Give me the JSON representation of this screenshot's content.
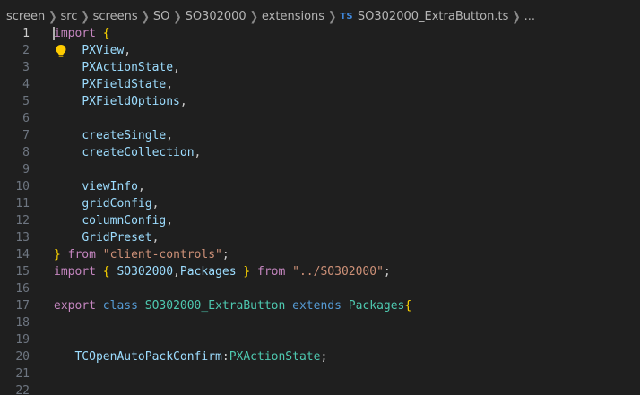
{
  "breadcrumb": {
    "items": [
      "screen",
      "src",
      "screens",
      "SO",
      "SO302000",
      "extensions"
    ],
    "file_badge": "TS",
    "file_name": "SO302000_ExtraButton.ts",
    "more": "..."
  },
  "editor": {
    "active_line": 1,
    "lightbulb_line": 2,
    "colors": {
      "background": "#1f1f1f",
      "line_number": "#6e7681",
      "keyword": "#569cd6",
      "control_keyword": "#c586c0",
      "type": "#4ec9b0",
      "identifier": "#9cdcfe",
      "string": "#ce9178",
      "brace": "#ffd700"
    },
    "lines": [
      {
        "n": "1",
        "tokens": [
          [
            "kw-ctrl",
            "import"
          ],
          [
            "punct",
            " "
          ],
          [
            "brace1",
            "{"
          ]
        ]
      },
      {
        "n": "2",
        "tokens": [
          [
            "punct",
            "    "
          ],
          [
            "ident",
            "PXView"
          ],
          [
            "punct",
            ","
          ]
        ]
      },
      {
        "n": "3",
        "tokens": [
          [
            "punct",
            "    "
          ],
          [
            "ident",
            "PXActionState"
          ],
          [
            "punct",
            ","
          ]
        ]
      },
      {
        "n": "4",
        "tokens": [
          [
            "punct",
            "    "
          ],
          [
            "ident",
            "PXFieldState"
          ],
          [
            "punct",
            ","
          ]
        ]
      },
      {
        "n": "5",
        "tokens": [
          [
            "punct",
            "    "
          ],
          [
            "ident",
            "PXFieldOptions"
          ],
          [
            "punct",
            ","
          ]
        ]
      },
      {
        "n": "6",
        "tokens": []
      },
      {
        "n": "7",
        "tokens": [
          [
            "punct",
            "    "
          ],
          [
            "ident",
            "createSingle"
          ],
          [
            "punct",
            ","
          ]
        ]
      },
      {
        "n": "8",
        "tokens": [
          [
            "punct",
            "    "
          ],
          [
            "ident",
            "createCollection"
          ],
          [
            "punct",
            ","
          ]
        ]
      },
      {
        "n": "9",
        "tokens": []
      },
      {
        "n": "10",
        "tokens": [
          [
            "punct",
            "    "
          ],
          [
            "ident",
            "viewInfo"
          ],
          [
            "punct",
            ","
          ]
        ]
      },
      {
        "n": "11",
        "tokens": [
          [
            "punct",
            "    "
          ],
          [
            "ident",
            "gridConfig"
          ],
          [
            "punct",
            ","
          ]
        ]
      },
      {
        "n": "12",
        "tokens": [
          [
            "punct",
            "    "
          ],
          [
            "ident",
            "columnConfig"
          ],
          [
            "punct",
            ","
          ]
        ]
      },
      {
        "n": "13",
        "tokens": [
          [
            "punct",
            "    "
          ],
          [
            "ident",
            "GridPreset"
          ],
          [
            "punct",
            ","
          ]
        ]
      },
      {
        "n": "14",
        "tokens": [
          [
            "brace1",
            "}"
          ],
          [
            "punct",
            " "
          ],
          [
            "kw-ctrl",
            "from"
          ],
          [
            "punct",
            " "
          ],
          [
            "str",
            "\"client-controls\""
          ],
          [
            "punct",
            ";"
          ]
        ]
      },
      {
        "n": "15",
        "tokens": [
          [
            "kw-ctrl",
            "import"
          ],
          [
            "punct",
            " "
          ],
          [
            "brace1",
            "{"
          ],
          [
            "punct",
            " "
          ],
          [
            "ident",
            "SO302000"
          ],
          [
            "punct",
            ","
          ],
          [
            "ident",
            "Packages"
          ],
          [
            "punct",
            " "
          ],
          [
            "brace1",
            "}"
          ],
          [
            "punct",
            " "
          ],
          [
            "kw-ctrl",
            "from"
          ],
          [
            "punct",
            " "
          ],
          [
            "str",
            "\"../SO302000\""
          ],
          [
            "punct",
            ";"
          ]
        ]
      },
      {
        "n": "16",
        "tokens": []
      },
      {
        "n": "17",
        "tokens": [
          [
            "kw-ctrl",
            "export"
          ],
          [
            "punct",
            " "
          ],
          [
            "kw",
            "class"
          ],
          [
            "punct",
            " "
          ],
          [
            "type",
            "SO302000_ExtraButton"
          ],
          [
            "punct",
            " "
          ],
          [
            "kw",
            "extends"
          ],
          [
            "punct",
            " "
          ],
          [
            "type",
            "Packages"
          ],
          [
            "brace1",
            "{"
          ]
        ]
      },
      {
        "n": "18",
        "tokens": []
      },
      {
        "n": "19",
        "tokens": []
      },
      {
        "n": "20",
        "tokens": [
          [
            "punct",
            "   "
          ],
          [
            "ident",
            "TCOpenAutoPackConfirm"
          ],
          [
            "punct",
            ":"
          ],
          [
            "type",
            "PXActionState"
          ],
          [
            "punct",
            ";"
          ]
        ]
      },
      {
        "n": "21",
        "tokens": []
      },
      {
        "n": "22",
        "tokens": []
      }
    ]
  }
}
